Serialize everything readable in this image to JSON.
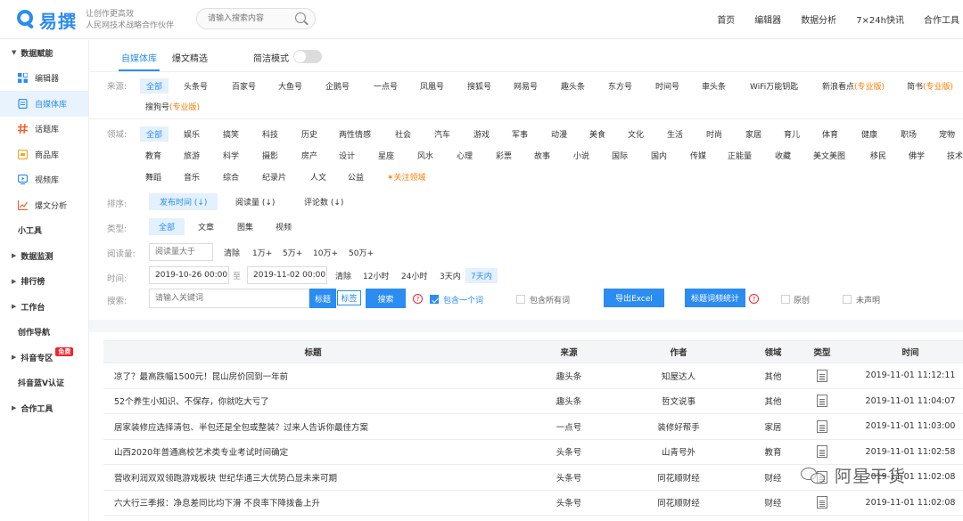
{
  "header": {
    "logo_text": "易撰",
    "slogan_line1": "让创作更高效",
    "slogan_line2": "人民网技术战略合作伙伴",
    "search_placeholder": "请输入搜索内容",
    "nav": [
      "首页",
      "编辑器",
      "数据分析",
      "7×24h快讯",
      "合作工具"
    ]
  },
  "sidebar": {
    "section1": "数据赋能",
    "items": [
      "编辑器",
      "自媒体库",
      "话题库",
      "商品库",
      "视频库",
      "爆文分析"
    ],
    "tools": "小工具",
    "section2": "数据监测",
    "section3": "排行榜",
    "section4": "工作台",
    "creation_nav": "创作导航",
    "douyin": "抖音专区",
    "free_badge": "免费",
    "douyin_v": "抖音蓝V认证",
    "section5": "合作工具"
  },
  "tabs": {
    "t1": "自媒体库",
    "t2": "爆文精选",
    "simple_mode": "简洁模式"
  },
  "source": {
    "label": "来源:",
    "items": [
      "全部",
      "头条号",
      "百家号",
      "大鱼号",
      "企鹅号",
      "一点号",
      "凤凰号",
      "搜狐号",
      "网易号",
      "趣头条",
      "东方号",
      "时间号",
      "車头条",
      "WiFi万能钥匙"
    ],
    "sina_a": "新浪看点",
    "sina_b": "(专业版)",
    "jianshu_a": "简书",
    "jianshu_b": "(专业版)",
    "sogou_a": "搜狗号",
    "sogou_b": "(专业版)"
  },
  "field": {
    "label": "领域:",
    "row1": [
      "全部",
      "娱乐",
      "搞笑",
      "科技",
      "历史",
      "两性情感",
      "社会",
      "汽车",
      "游戏",
      "军事",
      "动漫",
      "美食",
      "文化",
      "生活",
      "时尚",
      "家居",
      "育儿",
      "体育",
      "健康",
      "职场",
      "宠物"
    ],
    "row2": [
      "教育",
      "旅游",
      "科学",
      "摄影",
      "房产",
      "设计",
      "星座",
      "风水",
      "心理",
      "彩票",
      "故事",
      "小说",
      "国际",
      "国内",
      "传媒",
      "正能量",
      "收藏",
      "美文美图",
      "移民",
      "佛学",
      "技术"
    ],
    "row3": [
      "舞蹈",
      "音乐",
      "综合",
      "纪录片",
      "人文",
      "公益"
    ],
    "follow": "关注领域"
  },
  "sort": {
    "label": "排序:",
    "items": [
      "发布时间 (↓)",
      "阅读量 (↓)",
      "评论数 (↓)"
    ]
  },
  "type": {
    "label": "类型:",
    "items": [
      "全部",
      "文章",
      "图集",
      "视频"
    ]
  },
  "reads": {
    "label": "阅读量:",
    "placeholder": "阅读量大于",
    "clear": "清除",
    "items": [
      "1万+",
      "5万+",
      "10万+",
      "50万+"
    ]
  },
  "time": {
    "label": "时间:",
    "start": "2019-10-26 00:00",
    "to": "至",
    "end": "2019-11-02 00:00",
    "clear": "清除",
    "items": [
      "12小时",
      "24小时",
      "3天内",
      "7天内"
    ]
  },
  "search": {
    "label": "搜索:",
    "placeholder": "请输入关键词",
    "title_btn": "标题",
    "tag_btn": "标签",
    "search_btn": "搜索",
    "contains_one": "包含一个词",
    "contains_all": "包含所有词",
    "export": "导出Excel",
    "title_stats": "标题词频统计",
    "original": "原创",
    "undeclared": "未声明"
  },
  "table": {
    "headers": [
      "标题",
      "来源",
      "作者",
      "领域",
      "类型",
      "时间"
    ],
    "rows": [
      {
        "title": "凉了？最高跌幅1500元！昆山房价回到一年前",
        "source": "趣头条",
        "author": "知屋达人",
        "field": "其他",
        "time": "2019-11-01 11:12:11"
      },
      {
        "title": "52个养生小知识、不保存，你就吃大亏了",
        "source": "趣头条",
        "author": "哲文说事",
        "field": "其他",
        "time": "2019-11-01 11:04:07"
      },
      {
        "title": "居家装修应选择清包、半包还是全包或整装？过来人告诉你最佳方案",
        "source": "一点号",
        "author": "装修好帮手",
        "field": "家居",
        "time": "2019-11-01 11:03:00"
      },
      {
        "title": "山西2020年普通高校艺术类专业考试时间确定",
        "source": "头条号",
        "author": "山青号外",
        "field": "教育",
        "time": "2019-11-01 11:02:58"
      },
      {
        "title": "营收利润双双领跑游戏板块 世纪华通三大优势凸显未来可期",
        "source": "头条号",
        "author": "同花顺财经",
        "field": "财经",
        "time": "2019-11-01 11:02:08"
      },
      {
        "title": "六大行三季报：净息差同比均下滑 不良率下降拨备上升",
        "source": "头条号",
        "author": "同花顺财经",
        "field": "财经",
        "time": "2019-11-01 11:02:08"
      }
    ]
  },
  "watermark": "阿星干货",
  "colors": {
    "accent": "#2b8cf2",
    "pro": "#ff7a00",
    "badge": "#f5222d"
  }
}
